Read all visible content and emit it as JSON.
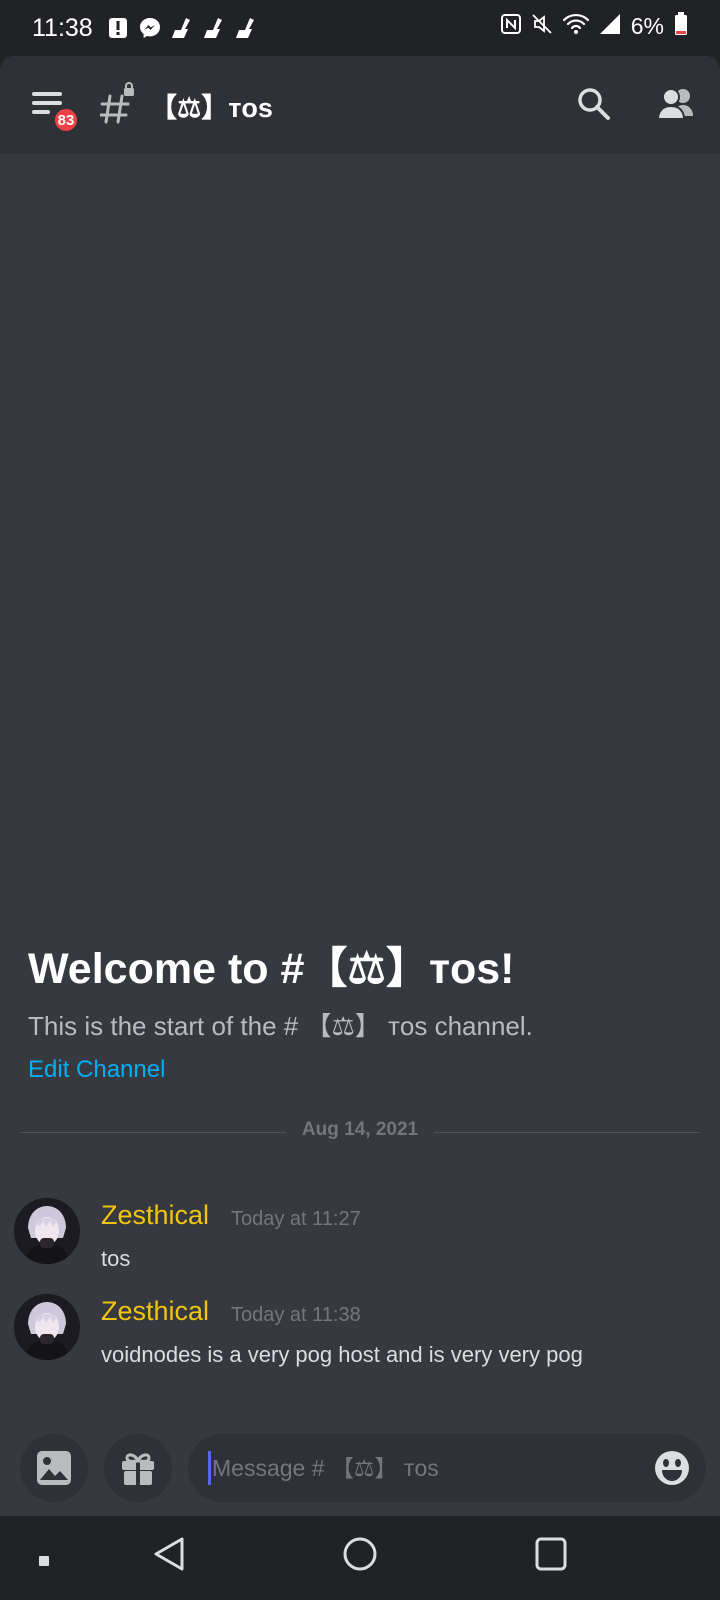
{
  "status_bar": {
    "time": "11:38",
    "battery_percent": "6%"
  },
  "header": {
    "notification_count": "83",
    "channel_name": "【⚖】ᴛᴏs"
  },
  "welcome": {
    "title": "Welcome to #【⚖】ᴛᴏs!",
    "subtitle": "This is the start of the # 【⚖】 ᴛᴏs channel.",
    "edit_link": "Edit Channel"
  },
  "divider_date": "Aug 14, 2021",
  "messages": [
    {
      "author": "Zesthical",
      "timestamp": "Today at 11:27",
      "text": "tos"
    },
    {
      "author": "Zesthical",
      "timestamp": "Today at 11:38",
      "text": "voidnodes is a very pog host and is very very pog"
    }
  ],
  "composer": {
    "placeholder": "Message # 【⚖】 ᴛᴏs"
  },
  "colors": {
    "background": "#36393f",
    "header": "#2f3136",
    "author_name": "#f1c40f",
    "link": "#00aff4",
    "badge": "#ed4245"
  },
  "icons": [
    "menu-icon",
    "hash-lock-icon",
    "search-icon",
    "members-icon",
    "image-icon",
    "gift-icon",
    "emoji-icon",
    "back-icon",
    "home-icon",
    "recents-icon"
  ]
}
